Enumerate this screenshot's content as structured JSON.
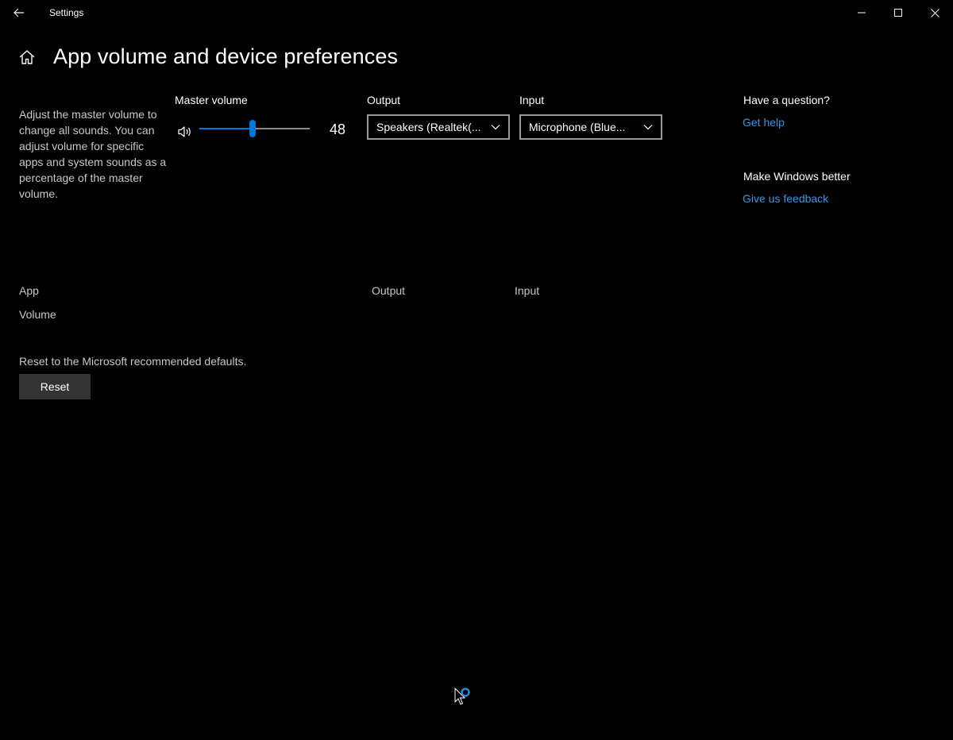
{
  "window": {
    "title": "Settings",
    "back_icon": "back-arrow-icon",
    "controls": [
      "minimize-icon",
      "maximize-icon",
      "close-icon"
    ]
  },
  "header": {
    "home_icon": "home-icon",
    "title": "App volume and device preferences"
  },
  "description": "Adjust the master volume to change all sounds. You can adjust volume for specific apps and system sounds as a percentage of the master volume.",
  "master_volume": {
    "label": "Master volume",
    "icon": "speaker-icon",
    "value": "48",
    "level_percent": 48,
    "accent": "#0078d7"
  },
  "output": {
    "label": "Output",
    "selected": "Speakers (Realtek(..."
  },
  "input": {
    "label": "Input",
    "selected": "Microphone (Blue..."
  },
  "help": {
    "question": "Have a question?",
    "get_help": "Get help",
    "better": "Make Windows better",
    "feedback": "Give us feedback",
    "link_color": "#3b94e6"
  },
  "table": {
    "app_header": "App",
    "volume_header": "Volume",
    "output_header": "Output",
    "input_header": "Input"
  },
  "reset": {
    "text": "Reset to the Microsoft recommended defaults.",
    "button": "Reset"
  }
}
